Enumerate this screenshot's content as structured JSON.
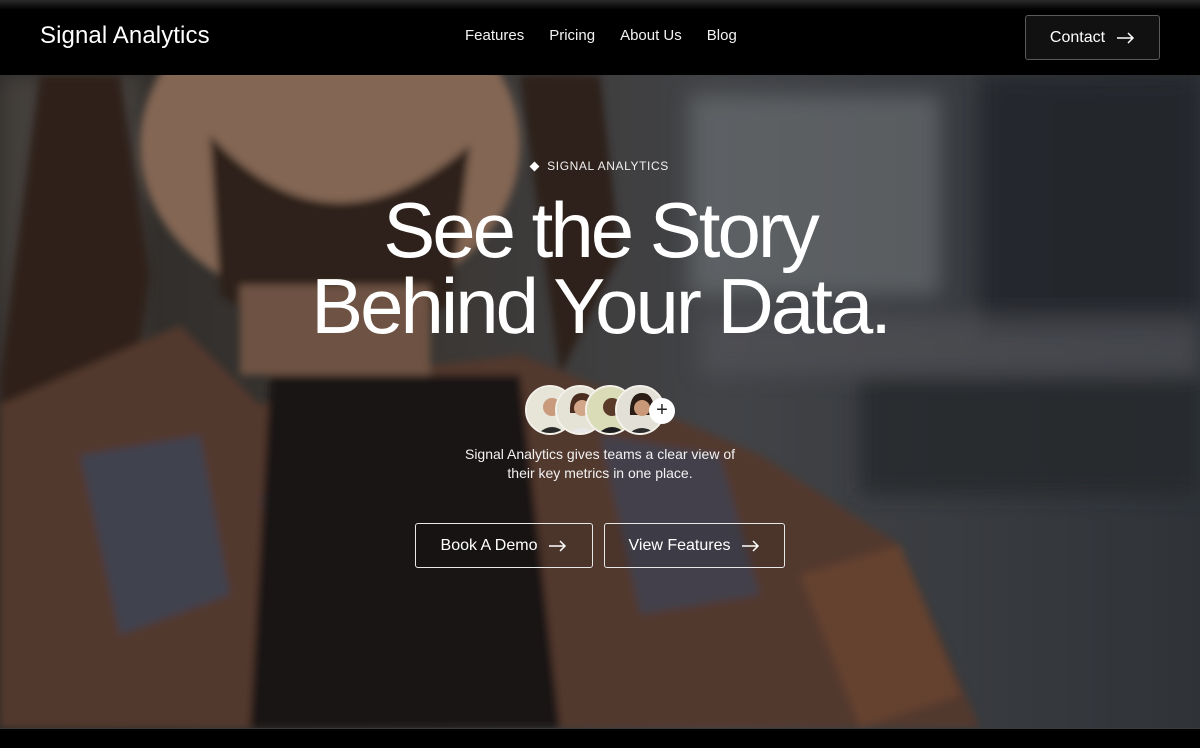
{
  "header": {
    "brand": "Signal Analytics",
    "nav": [
      {
        "label": "Features"
      },
      {
        "label": "Pricing"
      },
      {
        "label": "About Us"
      },
      {
        "label": "Blog"
      }
    ],
    "contact_label": "Contact",
    "contact_icon": "arrow-right-icon"
  },
  "hero": {
    "eyebrow": "SIGNAL ANALYTICS",
    "eyebrow_icon": "diamond-icon",
    "headline_line1": "See the Story",
    "headline_line2": "Behind Your Data.",
    "avatar_more_icon": "plus-icon",
    "subtext_line1": "Signal Analytics gives teams a clear view of",
    "subtext_line2": "their key metrics in one place.",
    "buttons": {
      "demo_label": "Book A Demo",
      "features_label": "View Features",
      "icon": "arrow-right-icon"
    }
  },
  "colors": {
    "background": "#000000",
    "text": "#ffffff",
    "button_border": "#e8e8e8"
  }
}
